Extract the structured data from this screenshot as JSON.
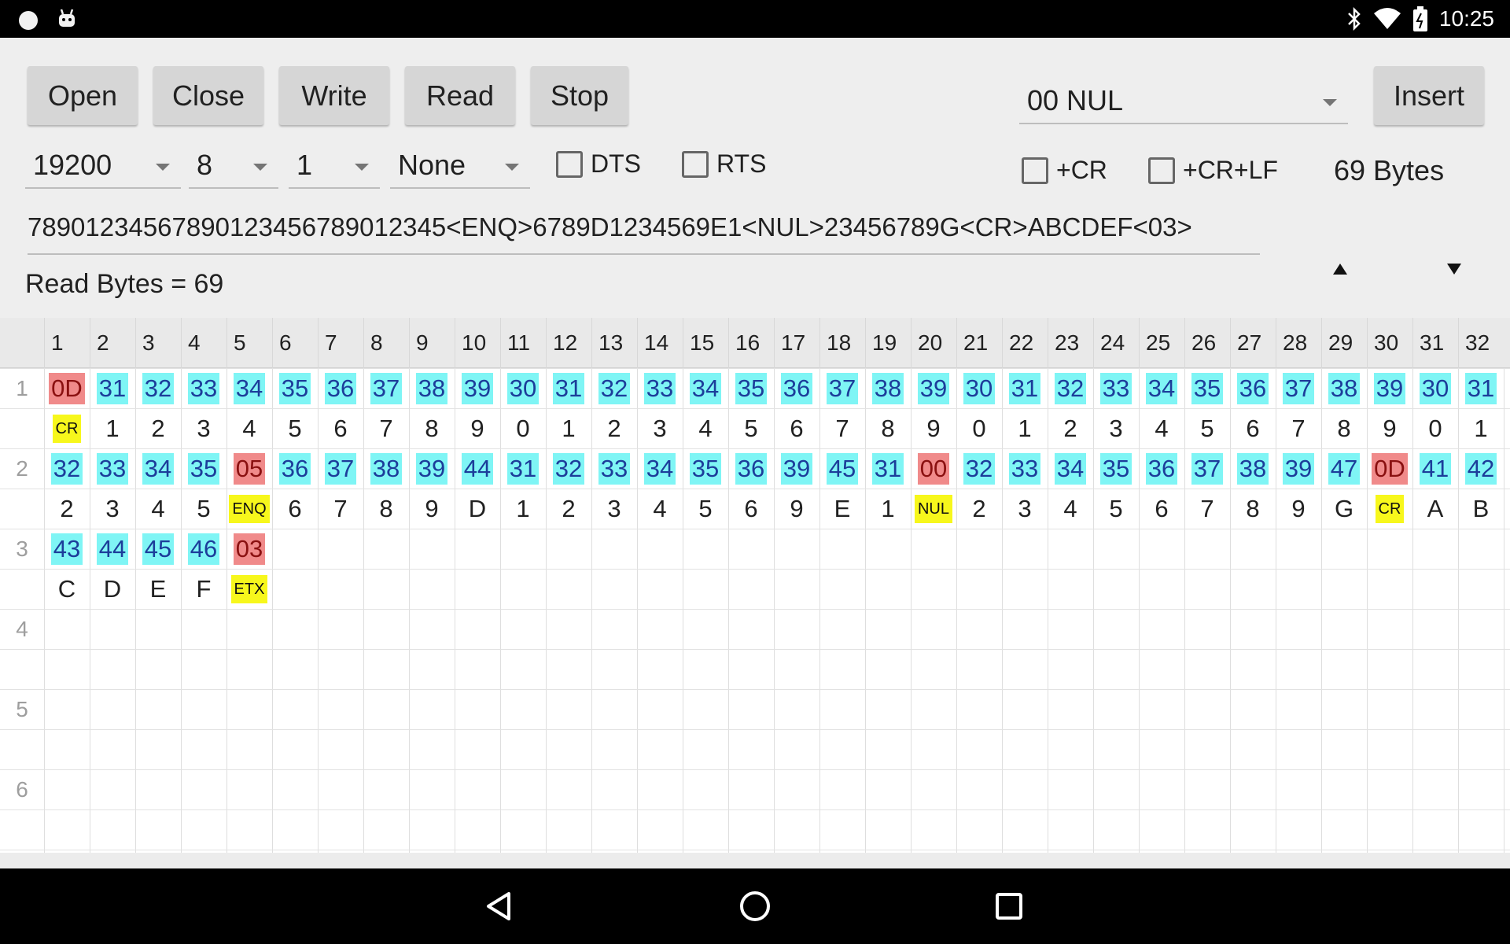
{
  "status_bar": {
    "time": "10:25",
    "icons": [
      "circle-icon",
      "android-icon",
      "bluetooth-icon",
      "wifi-icon",
      "battery-icon"
    ]
  },
  "toolbar": {
    "open_label": "Open",
    "close_label": "Close",
    "write_label": "Write",
    "read_label": "Read",
    "stop_label": "Stop",
    "insert_label": "Insert",
    "insert_char_value": "00 NUL"
  },
  "settings": {
    "baud_rate": "19200",
    "data_bits": "8",
    "stop_bits": "1",
    "parity": "None",
    "dts_label": "DTS",
    "rts_label": "RTS",
    "cr_label": "+CR",
    "crlf_label": "+CR+LF",
    "byte_count": "69 Bytes"
  },
  "data_line": "78901234567890123456789012345<ENQ>6789D1234569E1<NUL>23456789G<CR>ABCDEF<03>",
  "read_status": "Read Bytes = 69",
  "grid": {
    "columns": [
      "1",
      "2",
      "3",
      "4",
      "5",
      "6",
      "7",
      "8",
      "9",
      "10",
      "11",
      "12",
      "13",
      "14",
      "15",
      "16",
      "17",
      "18",
      "19",
      "20",
      "21",
      "22",
      "23",
      "24",
      "25",
      "26",
      "27",
      "28",
      "29",
      "30",
      "31",
      "32"
    ],
    "row_numbers": [
      "1",
      "2",
      "3",
      "4",
      "5",
      "6"
    ],
    "rows": [
      {
        "hex": [
          "0D",
          "31",
          "32",
          "33",
          "34",
          "35",
          "36",
          "37",
          "38",
          "39",
          "30",
          "31",
          "32",
          "33",
          "34",
          "35",
          "36",
          "37",
          "38",
          "39",
          "30",
          "31",
          "32",
          "33",
          "34",
          "35",
          "36",
          "37",
          "38",
          "39",
          "30",
          "31"
        ],
        "chars": [
          "CR",
          "1",
          "2",
          "3",
          "4",
          "5",
          "6",
          "7",
          "8",
          "9",
          "0",
          "1",
          "2",
          "3",
          "4",
          "5",
          "6",
          "7",
          "8",
          "9",
          "0",
          "1",
          "2",
          "3",
          "4",
          "5",
          "6",
          "7",
          "8",
          "9",
          "0",
          "1"
        ],
        "ctrl": [
          0
        ]
      },
      {
        "hex": [
          "32",
          "33",
          "34",
          "35",
          "05",
          "36",
          "37",
          "38",
          "39",
          "44",
          "31",
          "32",
          "33",
          "34",
          "35",
          "36",
          "39",
          "45",
          "31",
          "00",
          "32",
          "33",
          "34",
          "35",
          "36",
          "37",
          "38",
          "39",
          "47",
          "0D",
          "41",
          "42"
        ],
        "chars": [
          "2",
          "3",
          "4",
          "5",
          "ENQ",
          "6",
          "7",
          "8",
          "9",
          "D",
          "1",
          "2",
          "3",
          "4",
          "5",
          "6",
          "9",
          "E",
          "1",
          "NUL",
          "2",
          "3",
          "4",
          "5",
          "6",
          "7",
          "8",
          "9",
          "G",
          "CR",
          "A",
          "B"
        ],
        "ctrl": [
          4,
          19,
          29
        ]
      },
      {
        "hex": [
          "43",
          "44",
          "45",
          "46",
          "03"
        ],
        "chars": [
          "C",
          "D",
          "E",
          "F",
          "ETX"
        ],
        "ctrl": [
          4
        ]
      }
    ]
  }
}
